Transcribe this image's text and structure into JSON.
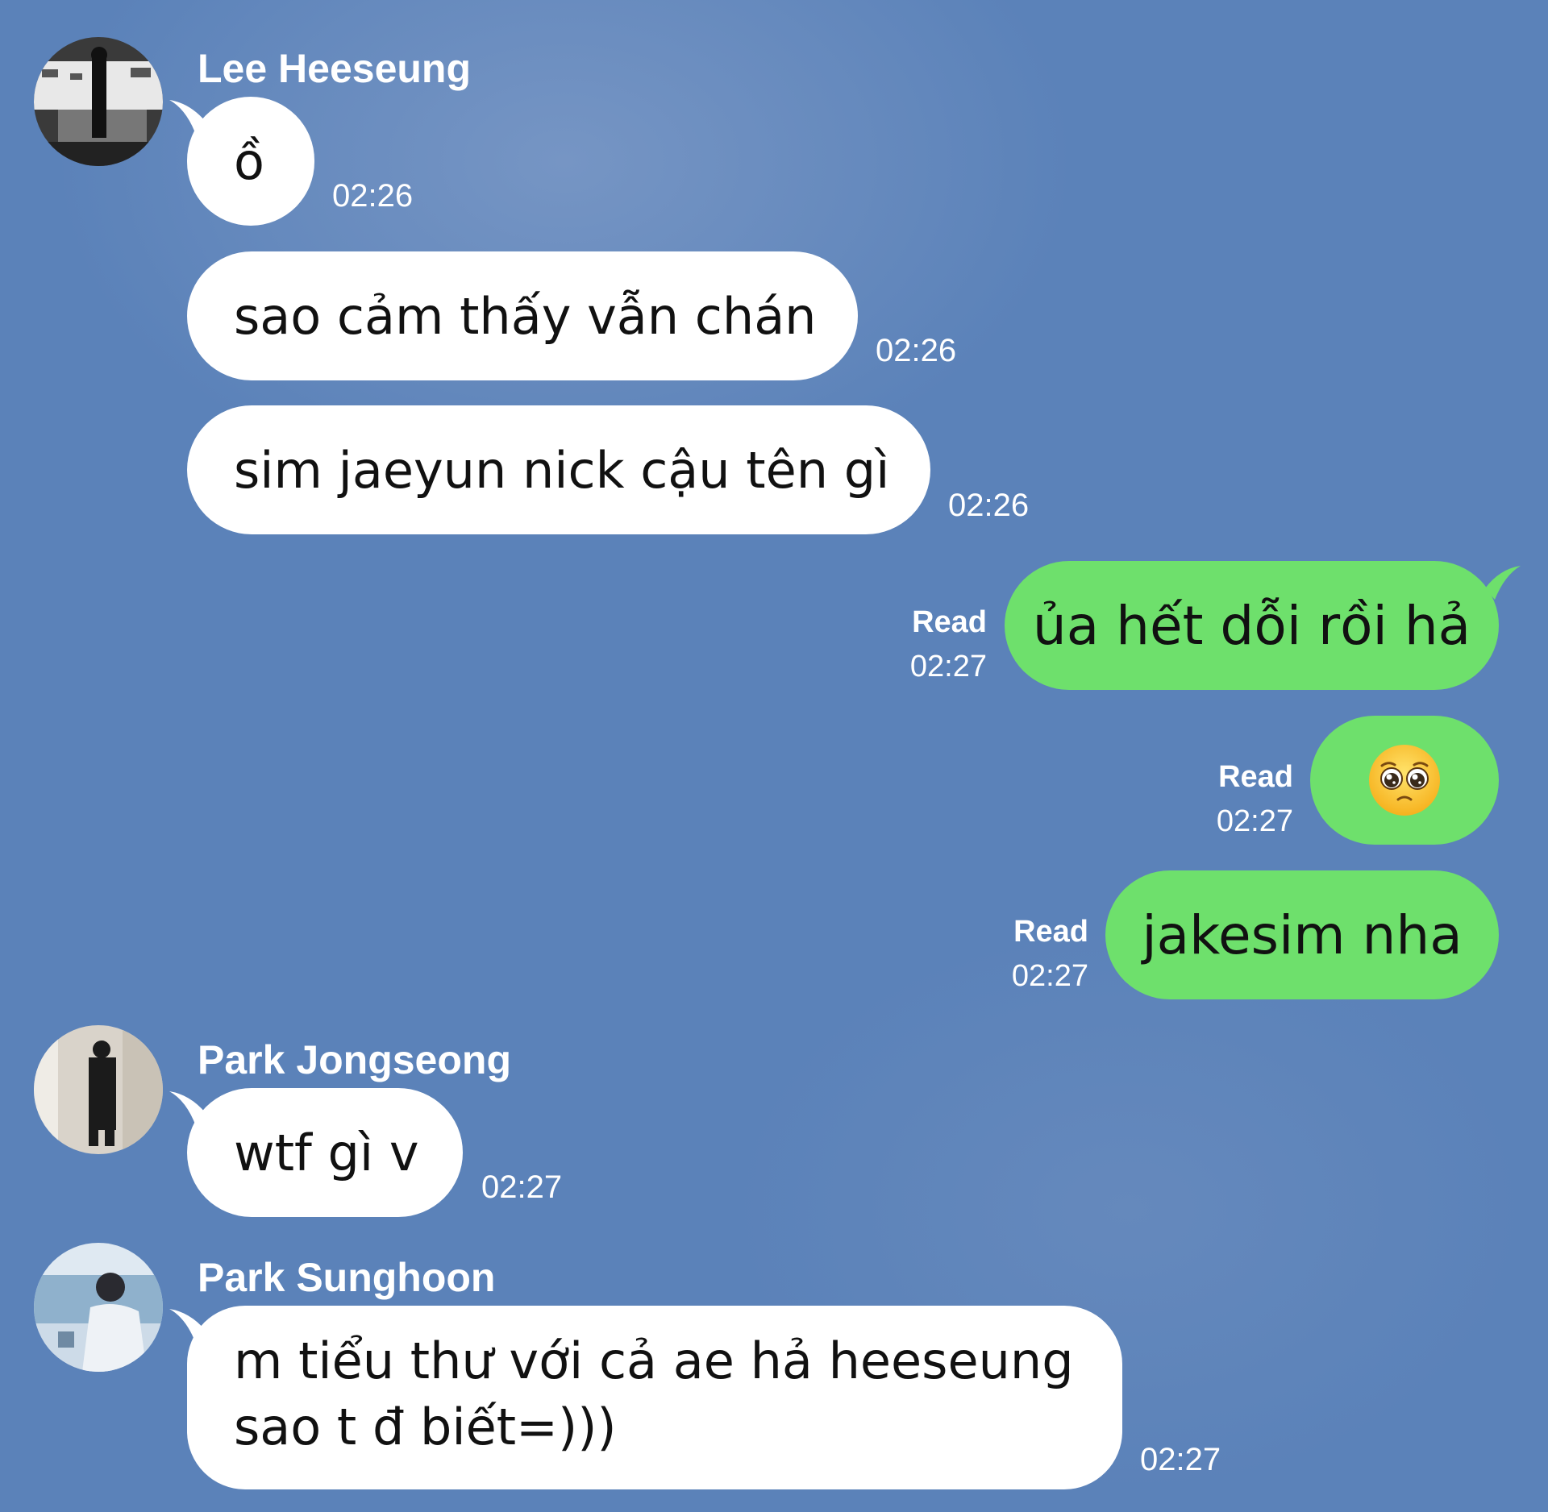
{
  "conversation": {
    "messages": [
      {
        "sender": "Lee Heeseung",
        "text": "ồ",
        "time": "02:26"
      },
      {
        "sender": "Lee Heeseung",
        "text": "sao cảm thấy vẫn chán",
        "time": "02:26"
      },
      {
        "sender": "Lee Heeseung",
        "text": "sim jaeyun nick cậu tên gì",
        "time": "02:26"
      },
      {
        "sender": "me",
        "text": "ủa hết dỗi rồi hả",
        "read_label": "Read",
        "time": "02:27"
      },
      {
        "sender": "me",
        "emoji": "pleading-face-icon",
        "read_label": "Read",
        "time": "02:27"
      },
      {
        "sender": "me",
        "text": "jakesim nha",
        "read_label": "Read",
        "time": "02:27"
      },
      {
        "sender": "Park Jongseong",
        "text": "wtf gì v",
        "time": "02:27"
      },
      {
        "sender": "Park Sunghoon",
        "text_lines": [
          "m tiểu thư với cả ae hả heeseung",
          "sao t đ biết=)))"
        ],
        "time": "02:27"
      }
    ]
  },
  "colors": {
    "background": "#5b82b9",
    "incoming_bubble": "#ffffff",
    "outgoing_bubble": "#6ee06c",
    "meta_text": "#ffffff"
  }
}
